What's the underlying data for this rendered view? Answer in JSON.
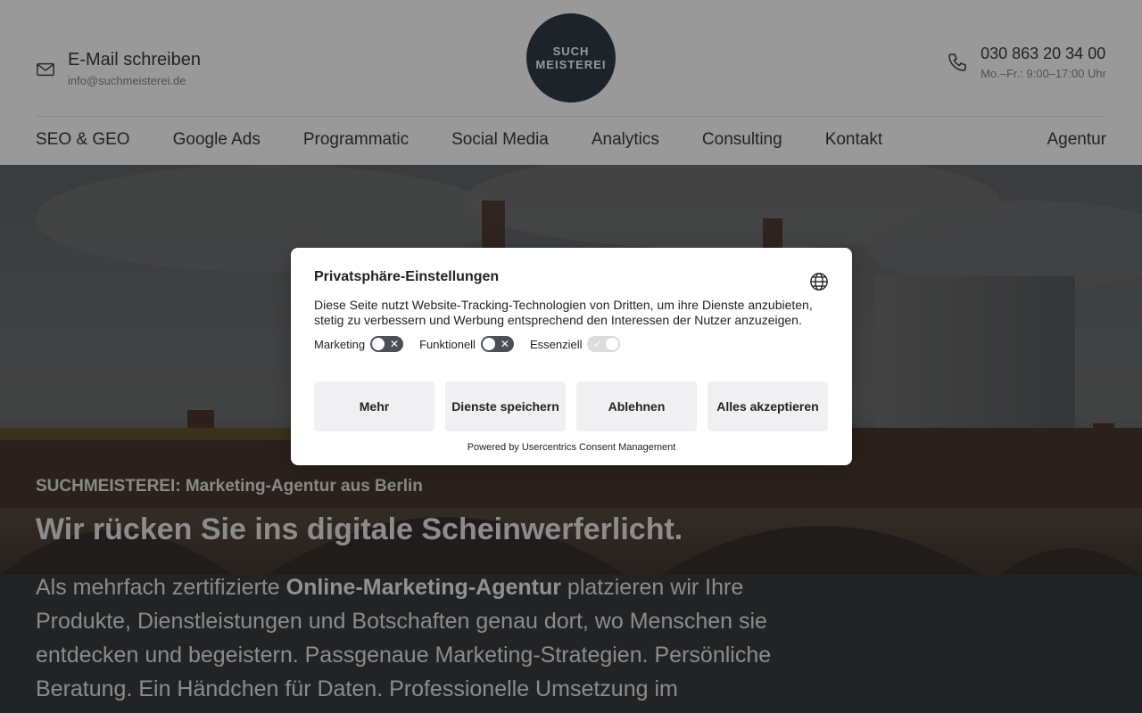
{
  "header": {
    "email_title": "E-Mail schreiben",
    "email_address": "info@suchmeisterei.de",
    "logo_line1": "SUCH",
    "logo_line2": "MEISTEREI",
    "phone": "030 863 20 34 00",
    "hours": "Mo.–Fr.: 9:00–17:00 Uhr"
  },
  "nav": {
    "items": [
      "SEO & GEO",
      "Google Ads",
      "Programmatic",
      "Social Media",
      "Analytics",
      "Consulting",
      "Kontakt"
    ],
    "right": "Agentur"
  },
  "hero": {
    "kicker": "SUCHMEISTEREI: Marketing-Agentur aus Berlin",
    "title": "Wir rücken Sie ins digitale Scheinwerferlicht.",
    "text_before": "Als mehrfach zertifizierte ",
    "text_bold": "Online-Marketing-Agentur",
    "text_after": " platzieren wir Ihre Produkte, Dienstleistungen und Botschaften genau dort, wo Menschen sie entdecken und begeistern. Passgenaue Marketing-Strategien. Persönliche Beratung. Ein Händchen für Daten. Professionelle Umsetzung im"
  },
  "consent": {
    "title": "Privatsphäre-Einstellungen",
    "description": "Diese Seite nutzt Website-Tracking-Technologien von Dritten, um ihre Dienste anzubieten, stetig zu verbessern und Werbung entsprechend den Interessen der Nutzer anzuzeigen.",
    "toggles": [
      {
        "label": "Marketing",
        "state": "off"
      },
      {
        "label": "Funktionell",
        "state": "off"
      },
      {
        "label": "Essenziell",
        "state": "on"
      }
    ],
    "buttons": {
      "more": "Mehr",
      "save": "Dienste speichern",
      "deny": "Ablehnen",
      "accept": "Alles akzeptieren"
    },
    "powered_by": "Powered by Usercentrics Consent Management"
  },
  "colors": {
    "logo_bg": "#2f3b45",
    "button_bg": "#f0f0f2",
    "toggle_off": "#4b4f58"
  }
}
